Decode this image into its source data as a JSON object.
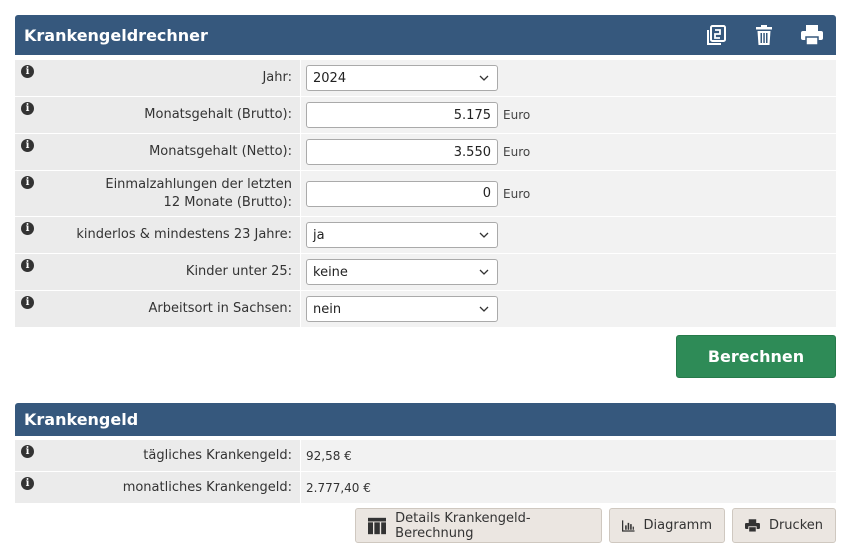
{
  "calculator": {
    "title": "Krankengeldrechner",
    "icons": [
      "copy-icon",
      "trash-icon",
      "print-icon"
    ],
    "rows": [
      {
        "label": "Jahr:",
        "type": "select",
        "value": "2024"
      },
      {
        "label": "Monatsgehalt (Brutto):",
        "type": "input",
        "value": "5.175",
        "unit": "Euro"
      },
      {
        "label": "Monatsgehalt (Netto):",
        "type": "input",
        "value": "3.550",
        "unit": "Euro"
      },
      {
        "label": "Einmalzahlungen der letzten 12 Monate (Brutto):",
        "type": "input",
        "value": "0",
        "unit": "Euro"
      },
      {
        "label": "kinderlos & mindestens 23 Jahre:",
        "type": "select",
        "value": "ja"
      },
      {
        "label": "Kinder unter 25:",
        "type": "select",
        "value": "keine"
      },
      {
        "label": "Arbeitsort in Sachsen:",
        "type": "select",
        "value": "nein"
      }
    ],
    "calculate_label": "Berechnen"
  },
  "results": {
    "title": "Krankengeld",
    "rows": [
      {
        "label": "tägliches Krankengeld:",
        "value": "92,58 €"
      },
      {
        "label": "monatliches Krankengeld:",
        "value": "2.777,40 €"
      }
    ]
  },
  "actions": {
    "details_label": "Details Krankengeld-Berechnung",
    "chart_label": "Diagramm",
    "print_label": "Drucken"
  },
  "colors": {
    "header": "#36587d",
    "calculate_button": "#2e8b57",
    "action_button": "#ebe6e1"
  }
}
